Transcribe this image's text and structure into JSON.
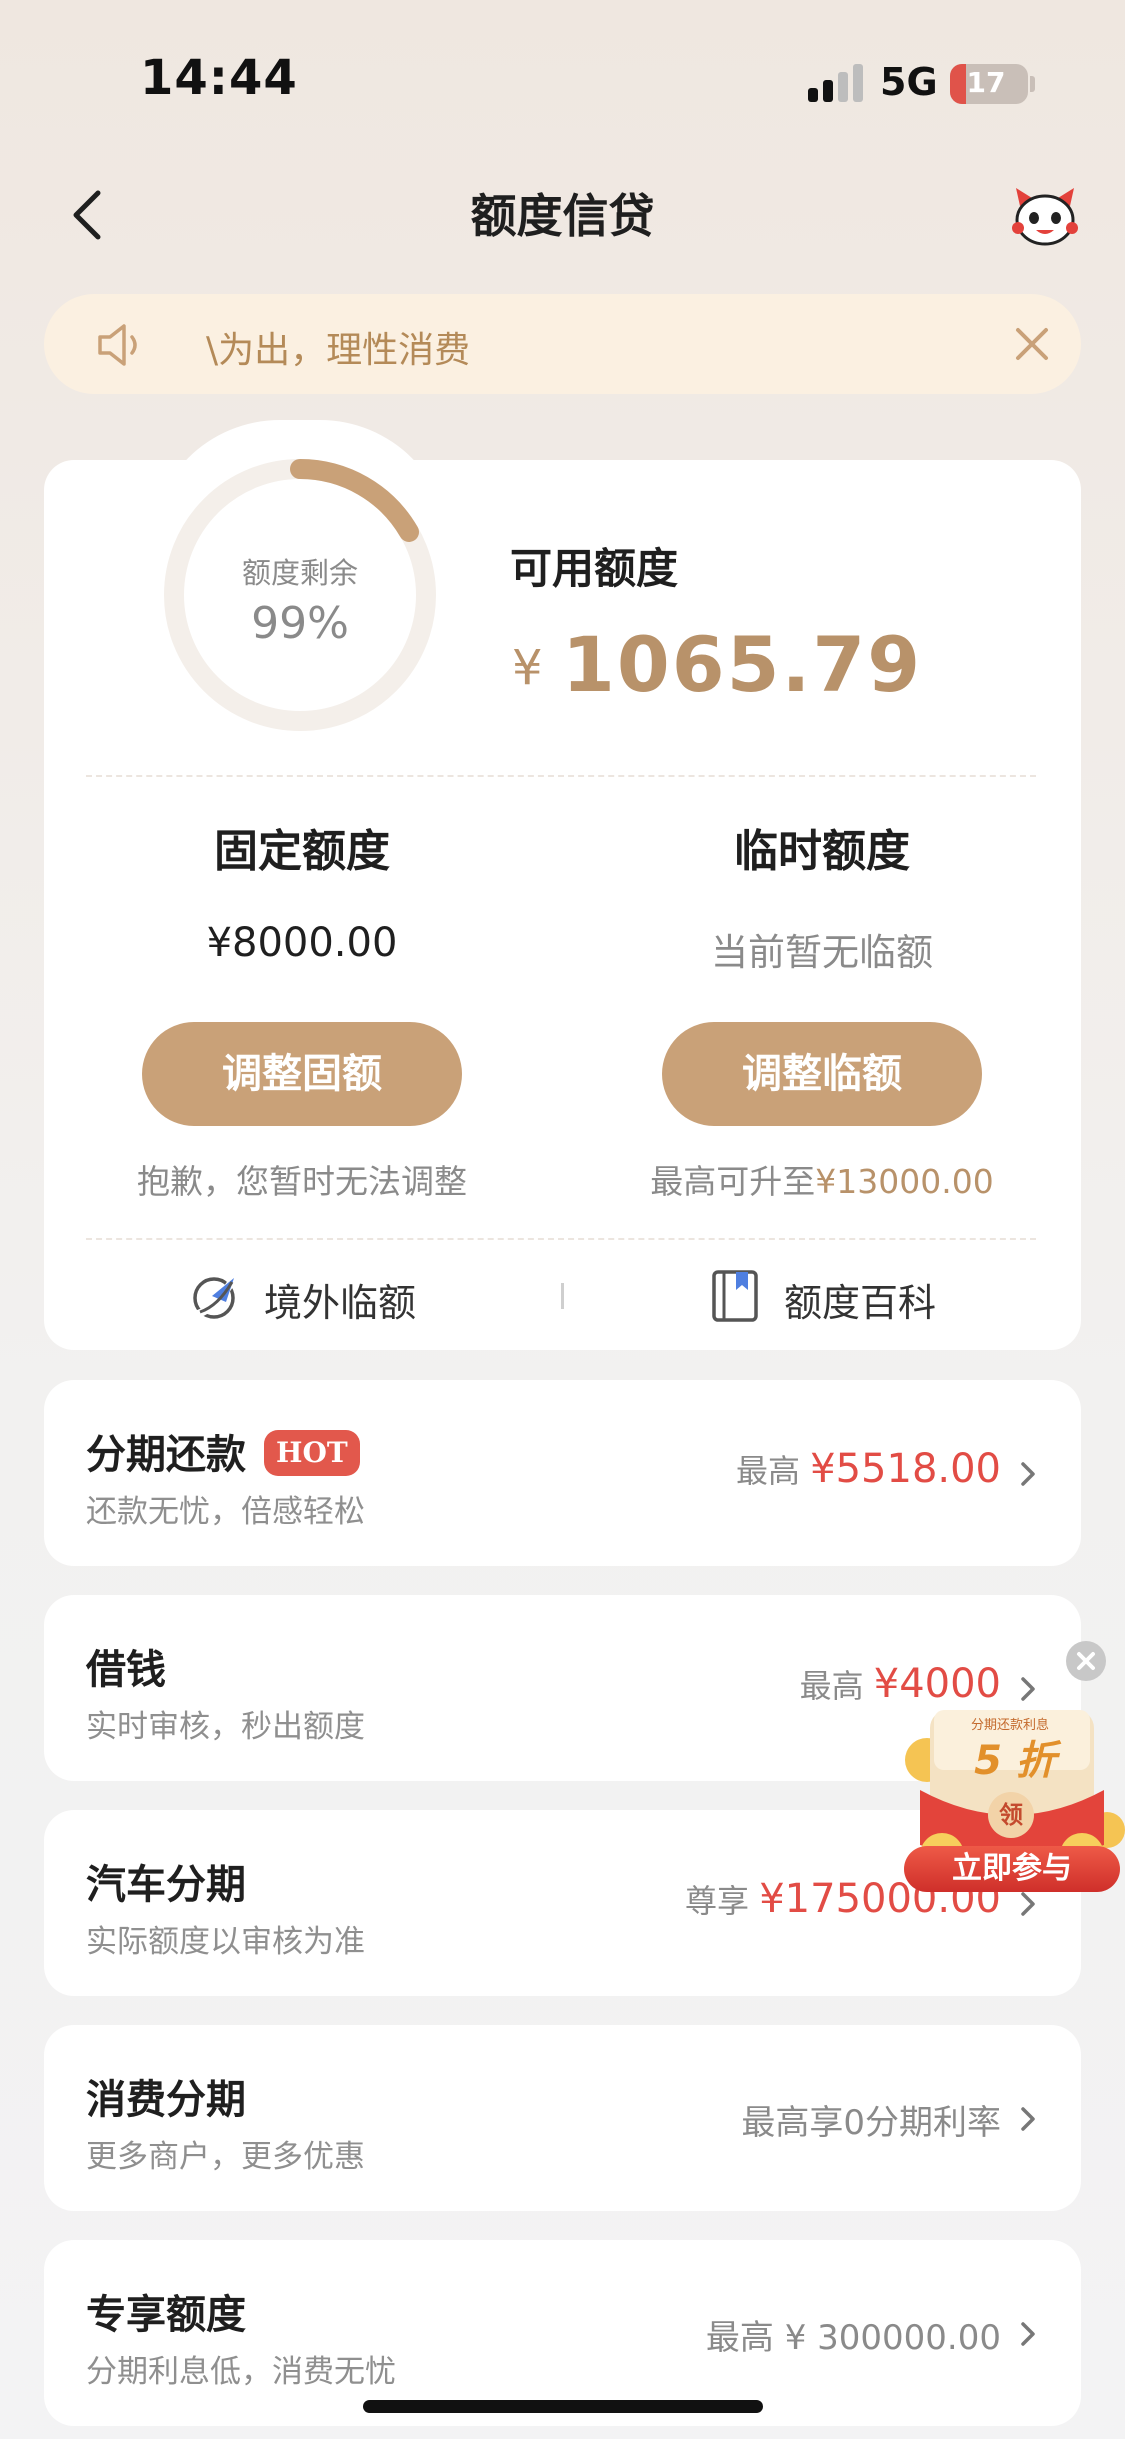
{
  "status_bar": {
    "time": "14:44",
    "network": "5G",
    "battery": "17"
  },
  "nav": {
    "title": "额度信贷",
    "back_icon": "chevron-left-icon",
    "mascot_icon": "mascot-icon"
  },
  "notice": {
    "text": "\\为出，理性消费",
    "icon": "speaker-icon"
  },
  "limit_card": {
    "ring_label": "额度剩余",
    "ring_value": "99%",
    "ring_progress": 0.99,
    "available_label": "可用额度",
    "currency": "¥",
    "available_amount": "1065.79",
    "fixed": {
      "title": "固定额度",
      "value": "¥8000.00",
      "button": "调整固额",
      "note": "抱歉，您暂时无法调整"
    },
    "temp": {
      "title": "临时额度",
      "value": "当前暂无临额",
      "button": "调整临额",
      "note_prefix": "最高可升至",
      "note_amount": "¥13000.00"
    },
    "links": [
      {
        "label": "境外临额",
        "icon": "plane-globe-icon"
      },
      {
        "label": "额度百科",
        "icon": "book-icon"
      }
    ]
  },
  "list": [
    {
      "title": "分期还款",
      "badge": "HOT",
      "subtitle": "还款无忧，倍感轻松",
      "prefix": "最高",
      "amount": "¥5518.00"
    },
    {
      "title": "借钱",
      "subtitle": "实时审核，秒出额度",
      "prefix": "最高",
      "amount": "¥4000"
    },
    {
      "title": "汽车分期",
      "subtitle": "实际额度以审核为准",
      "prefix": "尊享",
      "amount": "¥175000.00"
    },
    {
      "title": "消费分期",
      "subtitle": "更多商户，更多优惠",
      "right_text": "最高享0分期利率"
    },
    {
      "title": "专享额度",
      "subtitle": "分期利息低，消费无忧",
      "right_text": "最高 ¥ 300000.00"
    }
  ],
  "promo": {
    "tag": "分期还款利息",
    "discount": "5 折",
    "claim": "领",
    "button": "立即参与"
  },
  "colors": {
    "gold": "#b8926a",
    "button": "#c9a178",
    "red": "#e24c45",
    "notice_bg": "#fbf0e1"
  }
}
